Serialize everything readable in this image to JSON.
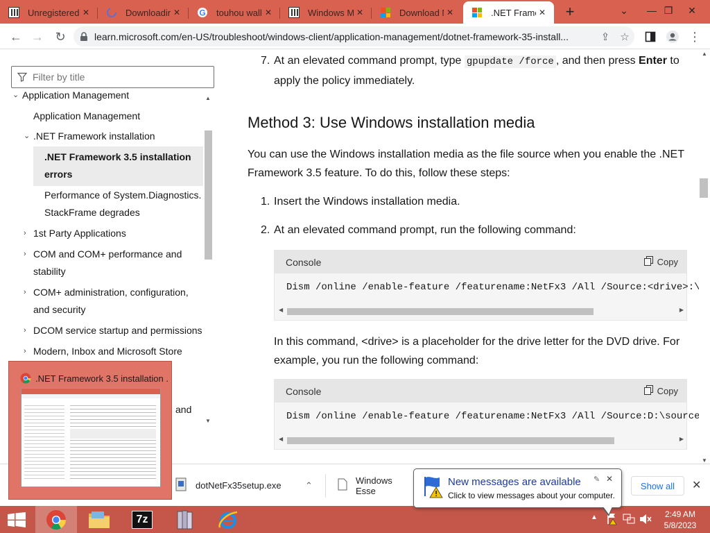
{
  "browser": {
    "tabs": [
      {
        "title": "Unregistered",
        "icon": "wiki-icon"
      },
      {
        "title": "Downloading",
        "icon": "loading-icon"
      },
      {
        "title": "touhou wallp",
        "icon": "google-icon"
      },
      {
        "title": "Windows Mo",
        "icon": "wiki-icon"
      },
      {
        "title": "Download M",
        "icon": "microsoft-icon"
      },
      {
        "title": ".NET Framew",
        "icon": "microsoft-icon",
        "active": true
      }
    ],
    "url": "learn.microsoft.com/en-US/troubleshoot/windows-client/application-management/dotnet-framework-35-install..."
  },
  "sidebar": {
    "filter_placeholder": "Filter by title",
    "items": [
      {
        "label": "Application Management",
        "chevron": "v"
      },
      {
        "label": "Application Management"
      },
      {
        "label": ".NET Framework installation",
        "chevron": "v"
      },
      {
        "label_line1": ".NET Framework 3.5 installation",
        "label_line2": "errors",
        "selected": true
      },
      {
        "label_line1": "Performance of System.Diagnostics.",
        "label_line2": "StackFrame degrades"
      },
      {
        "label": "1st Party Applications",
        "chevron": ">"
      },
      {
        "label_line1": "COM and COM+ performance and",
        "label_line2": "stability",
        "chevron": ">"
      },
      {
        "label_line1": "COM+ administration, configuration,",
        "label_line2": "and security",
        "chevron": ">"
      },
      {
        "label": "DCOM service startup and permissions",
        "chevron": ">"
      },
      {
        "label": "Modern, Inbox and Microsoft Store",
        "chevron": ">"
      },
      {
        "label": "and"
      }
    ]
  },
  "content": {
    "step7_num": "7.",
    "step7_pre": "At an elevated command prompt, type ",
    "step7_code": "gpupdate /force",
    "step7_mid": ", and then press ",
    "step7_bold": "Enter",
    "step7_post": " to apply the policy immediately.",
    "method3_heading": "Method 3: Use Windows installation media",
    "method3_intro": "You can use the Windows installation media as the file source when you enable the .NET Framework 3.5 feature. To do this, follow these steps:",
    "step1_num": "1.",
    "step1_text": "Insert the Windows installation media.",
    "step2_num": "2.",
    "step2_text": "At an elevated command prompt, run the following command:",
    "code1": {
      "lang": "Console",
      "copy": "Copy",
      "line": "Dism /online /enable-feature /featurename:NetFx3 /All /Source:<drive>:\\sour"
    },
    "explain": "In this command, <drive> is a placeholder for the drive letter for the DVD drive. For example, you run the following command:",
    "code2": {
      "lang": "Console",
      "copy": "Copy",
      "line": "Dism /online /enable-feature /featurename:NetFx3 /All /Source:D:\\sources\\sx"
    }
  },
  "downloads": {
    "item1": "dotNetFx35setup.exe",
    "item2": "Windows Esse",
    "show_all": "Show all"
  },
  "thumbnail": {
    "title": ".NET Framework 3.5 installation ..."
  },
  "notification": {
    "title": "New messages are available",
    "body": "Click to view messages about your computer."
  },
  "taskbar": {
    "time": "2:49 AM",
    "date": "5/8/2023"
  },
  "colors": {
    "tabstrip": "#d9614f",
    "taskbar": "#c45749",
    "link_blue": "#1a73e8"
  }
}
